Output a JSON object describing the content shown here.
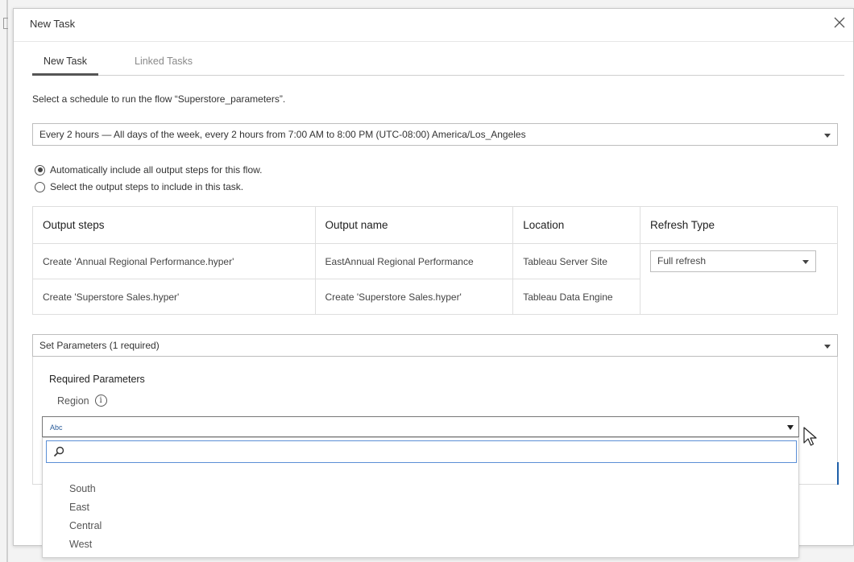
{
  "dialog": {
    "title": "New Task",
    "close_icon": "close-icon"
  },
  "tabs": [
    {
      "label": "New Task",
      "active": true
    },
    {
      "label": "Linked Tasks",
      "active": false
    }
  ],
  "instruction": "Select a schedule to run the flow “Superstore_parameters”.",
  "schedule": {
    "selected": "Every 2 hours — All days of the week, every 2 hours from 7:00 AM to 8:00 PM (UTC-08:00) America/Los_Angeles"
  },
  "output_options": [
    {
      "label": "Automatically include all output steps for this flow.",
      "checked": true
    },
    {
      "label": "Select the output steps to include in this task.",
      "checked": false
    }
  ],
  "table": {
    "headers": [
      "Output steps",
      "Output name",
      "Location",
      "Refresh Type"
    ],
    "rows": [
      [
        "Create 'Annual Regional Performance.hyper'",
        "EastAnnual Regional Performance",
        "Tableau Server Site"
      ],
      [
        "Create 'Superstore Sales.hyper'",
        "Create 'Superstore Sales.hyper'",
        "Tableau Data Engine"
      ]
    ],
    "refresh_type": "Full refresh"
  },
  "parameters": {
    "select_label": "Set Parameters (1 required)",
    "required_title": "Required Parameters",
    "region_label": "Region",
    "region_value": "Abc",
    "search_placeholder": "",
    "options": [
      "South",
      "East",
      "Central",
      "West"
    ]
  },
  "colors": {
    "accent": "#1f5fa8",
    "focus_border": "#5b8fd6"
  }
}
